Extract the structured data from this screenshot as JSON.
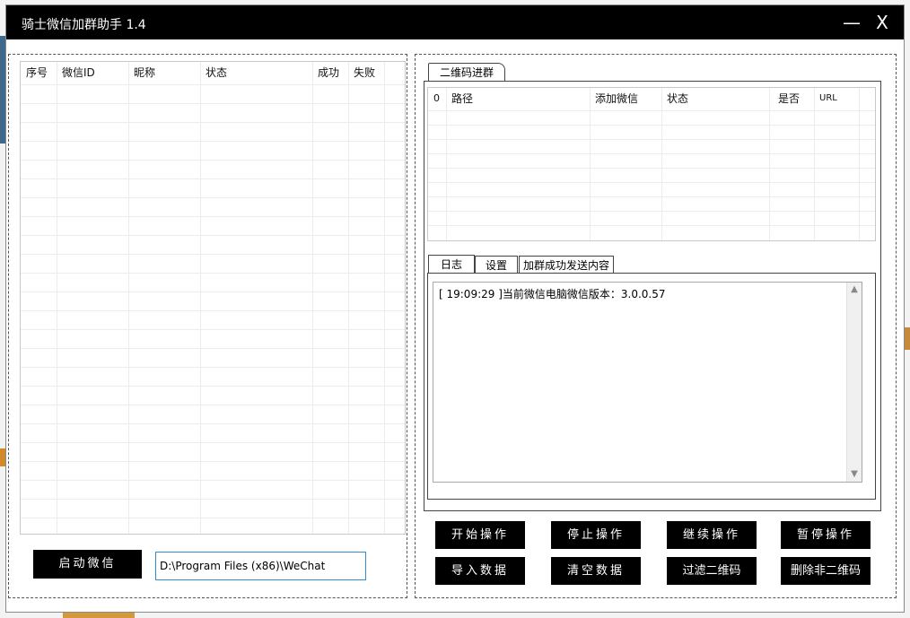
{
  "window": {
    "title": "骑士微信加群助手 1.4",
    "minimize_glyph": "—",
    "close_glyph": "X"
  },
  "left_grid": {
    "columns": [
      "序号",
      "微信ID",
      "昵称",
      "状态",
      "成功",
      "失败"
    ]
  },
  "qr_tab": {
    "label": "二维码进群"
  },
  "qr_grid": {
    "columns": [
      "0",
      "路径",
      "添加微信",
      "状态",
      "是否",
      "URL"
    ]
  },
  "log_tabs": [
    "日志",
    "设置",
    "加群成功发送内容"
  ],
  "log": {
    "lines": [
      "[ 19:09:29 ]当前微信电脑微信版本：3.0.0.57"
    ]
  },
  "bottom_left": {
    "start_wechat_label": "启动微信",
    "path_value": "D:\\Program Files (x86)\\WeChat"
  },
  "actions": {
    "start": "开始操作",
    "stop": "停止操作",
    "continue": "继续操作",
    "pause": "暂停操作",
    "import": "导入数据",
    "clear": "清空数据",
    "filter_qr": "过滤二维码",
    "delete_non_qr": "删除非二维码"
  },
  "colors": {
    "titlebar": "#000000",
    "button_bg": "#000000",
    "input_border": "#2b8cd8"
  }
}
